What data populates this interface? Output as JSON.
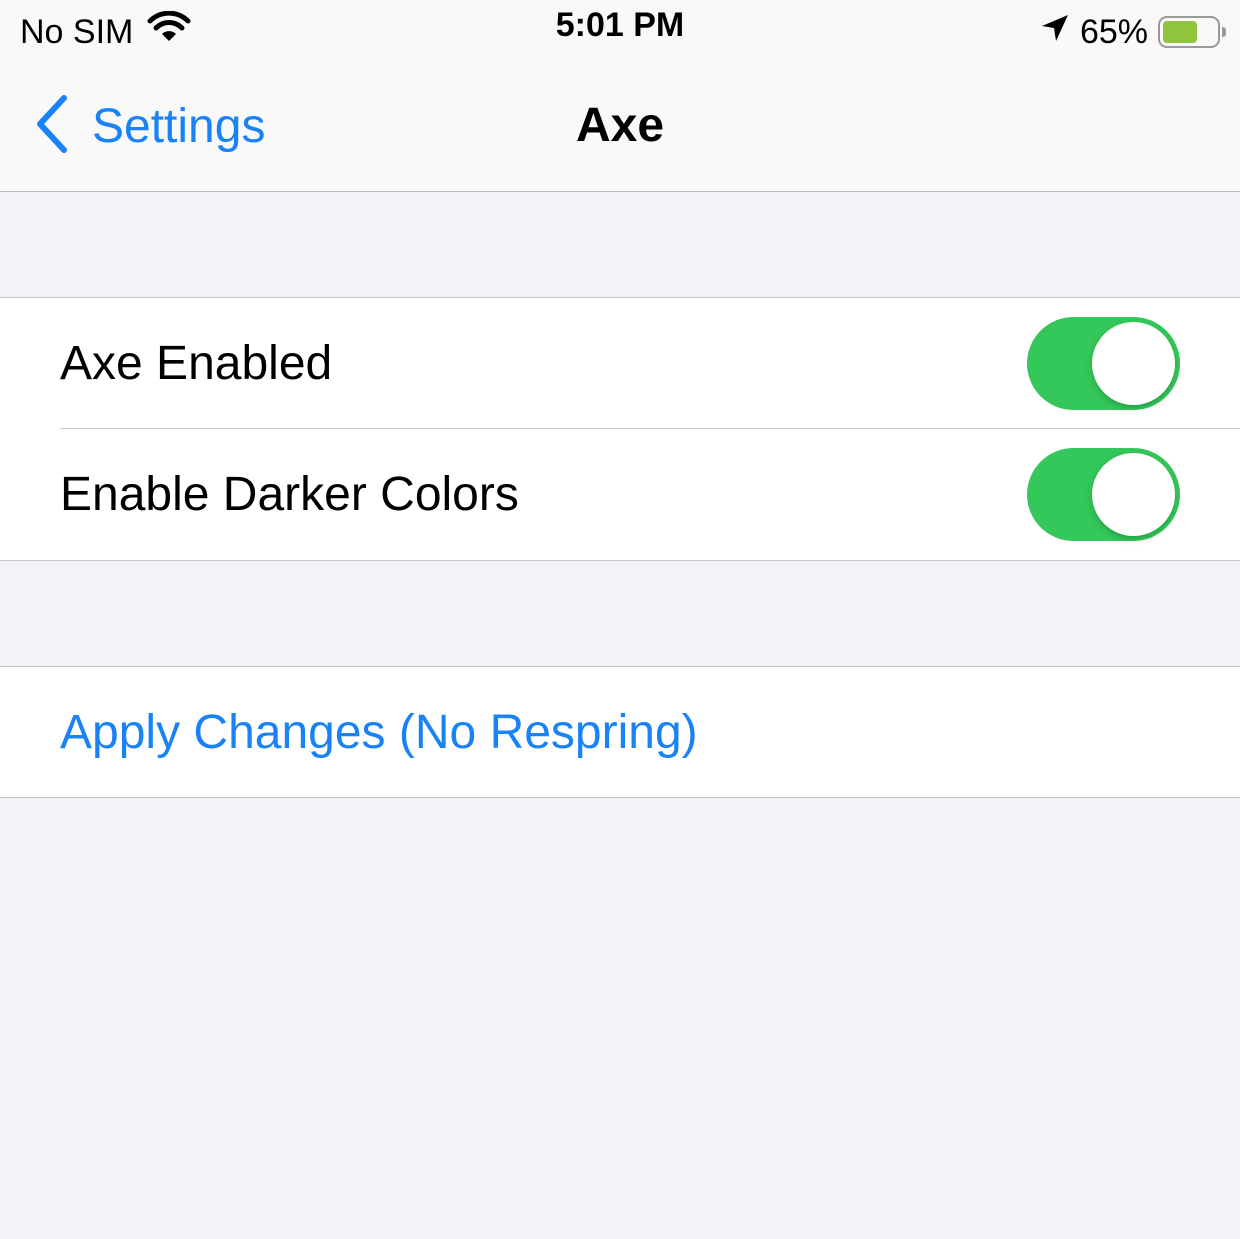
{
  "status_bar": {
    "carrier": "No SIM",
    "time": "5:01 PM",
    "battery_percent": "65%",
    "battery_level": 0.65,
    "icons": [
      "wifi-icon",
      "location-arrow-icon",
      "battery-icon"
    ]
  },
  "nav": {
    "back_label": "Settings",
    "title": "Axe"
  },
  "settings": {
    "toggles": [
      {
        "label": "Axe Enabled",
        "on": true
      },
      {
        "label": "Enable Darker Colors",
        "on": true
      }
    ],
    "action": {
      "label": "Apply Changes (No Respring)"
    }
  },
  "colors": {
    "accent": "#1a82f7",
    "toggle_on": "#34c759",
    "background": "#f2f2f7",
    "battery": "#8fc43c"
  }
}
